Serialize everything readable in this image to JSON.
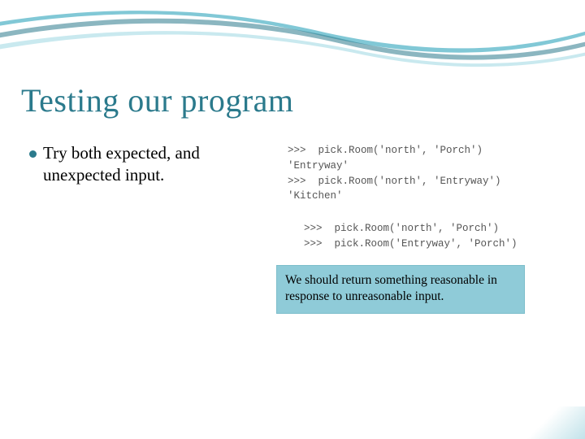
{
  "title": "Testing our program",
  "bullet": "Try both expected, and unexpected input.",
  "code1": ">>>  pick.Room('north', 'Porch')\n'Entryway'\n>>>  pick.Room('north', 'Entryway')\n'Kitchen'",
  "code2": ">>>  pick.Room('north', 'Porch')\n>>>  pick.Room('Entryway', 'Porch')",
  "callout": "We should return something reasonable in response to unreasonable input."
}
